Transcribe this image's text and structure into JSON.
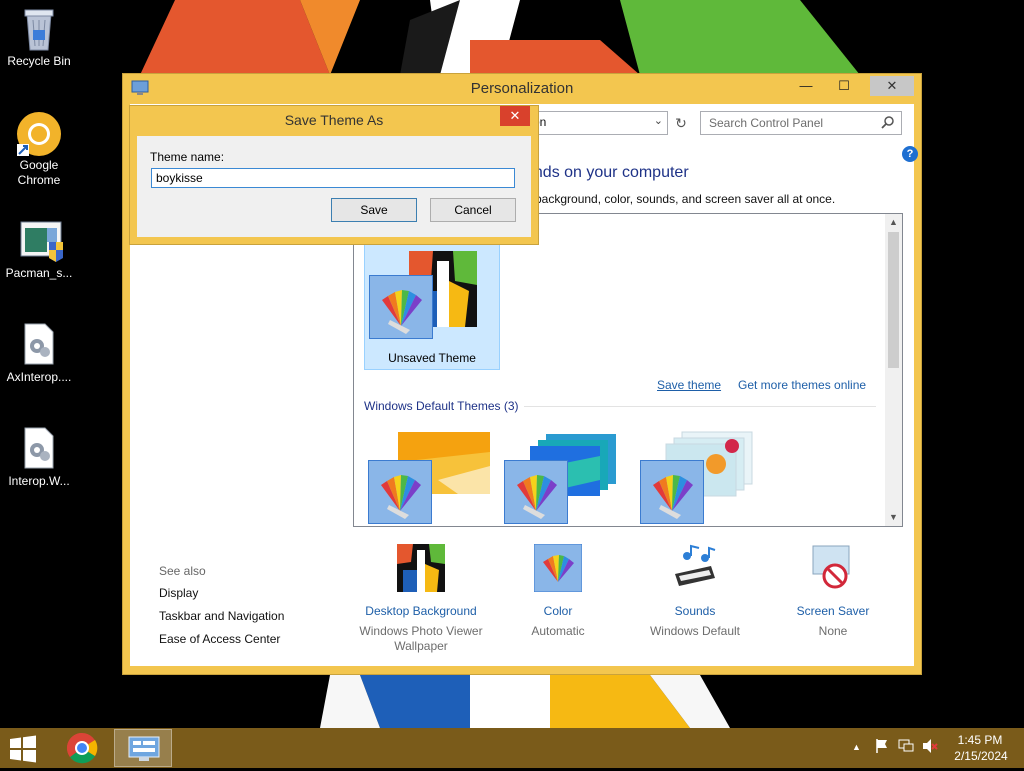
{
  "desktop": {
    "icons": [
      {
        "label": "Recycle Bin"
      },
      {
        "label": "Google Chrome"
      },
      {
        "label": "Pacman_s..."
      },
      {
        "label": "AxInterop...."
      },
      {
        "label": "Interop.W..."
      }
    ]
  },
  "window": {
    "title": "Personalization",
    "controls": {
      "minimize": "—",
      "maximize": "☐",
      "close": "✕"
    },
    "address_text": "on",
    "search_placeholder": "Search Control Panel",
    "help": "?",
    "heading": "unds on your computer",
    "subheading": "p background, color, sounds, and screen saver all at once.",
    "my_themes": {
      "unsaved_label": "Unsaved Theme",
      "save_theme_link": "Save theme",
      "get_more_link": "Get more themes online"
    },
    "default_themes_header": "Windows Default Themes (3)",
    "see_also": {
      "title": "See also",
      "links": [
        "Display",
        "Taskbar and Navigation",
        "Ease of Access Center"
      ]
    },
    "bottom_items": [
      {
        "title": "Desktop Background",
        "subtitle": "Windows Photo Viewer Wallpaper"
      },
      {
        "title": "Color",
        "subtitle": "Automatic"
      },
      {
        "title": "Sounds",
        "subtitle": "Windows Default"
      },
      {
        "title": "Screen Saver",
        "subtitle": "None"
      }
    ]
  },
  "dialog": {
    "title": "Save Theme As",
    "close": "✕",
    "label": "Theme name:",
    "value": "boykisse",
    "save_label": "Save",
    "cancel_label": "Cancel"
  },
  "taskbar": {
    "time": "1:45 PM",
    "date": "2/15/2024",
    "tray_chevron": "▲"
  },
  "colors": {
    "window_frame": "#f3c64f",
    "taskbar": "#7a5b1a",
    "link": "#1e5fa8",
    "heading": "#1e3287",
    "dialog_close": "#d9412c"
  }
}
